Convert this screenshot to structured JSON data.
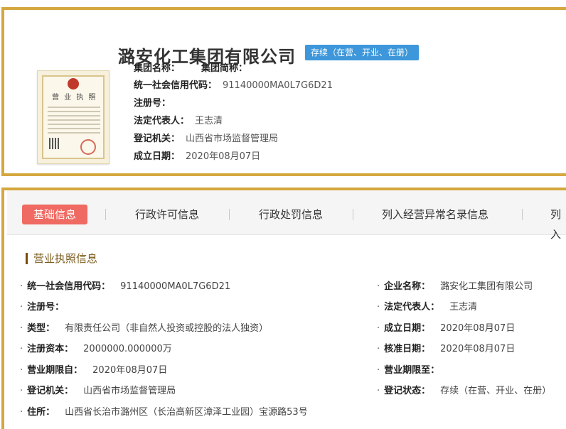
{
  "company": {
    "name": "潞安化工集团有限公司",
    "status": "存续（在营、开业、在册）",
    "license_image_title": "营 业 执 照"
  },
  "summary": [
    {
      "label": "集团名称：",
      "value": "",
      "label2": "集团简称："
    },
    {
      "label": "统一社会信用代码：",
      "value": "91140000MA0L7G6D21"
    },
    {
      "label": "注册号：",
      "value": ""
    },
    {
      "label": "法定代表人：",
      "value": "王志清"
    },
    {
      "label": "登记机关：",
      "value": "山西省市场监督管理局"
    },
    {
      "label": "成立日期：",
      "value": "2020年08月07日"
    }
  ],
  "tabs": [
    "基础信息",
    "行政许可信息",
    "行政处罚信息",
    "列入经营异常名录信息",
    "列入"
  ],
  "section": {
    "title": "营业执照信息"
  },
  "fields_left": [
    {
      "label": "统一社会信用代码：",
      "value": "91140000MA0L7G6D21"
    },
    {
      "label": "注册号：",
      "value": ""
    },
    {
      "label": "类型：",
      "value": "有限责任公司（非自然人投资或控股的法人独资）"
    },
    {
      "label": "注册资本：",
      "value": "2000000.000000万"
    },
    {
      "label": "营业期限自：",
      "value": "2020年08月07日"
    },
    {
      "label": "登记机关：",
      "value": "山西省市场监督管理局"
    },
    {
      "label": "住所：",
      "value": "山西省长治市潞州区（长治高新区漳泽工业园）宝源路53号"
    }
  ],
  "fields_right": [
    {
      "label": "企业名称：",
      "value": "潞安化工集团有限公司"
    },
    {
      "label": "法定代表人：",
      "value": "王志清"
    },
    {
      "label": "成立日期：",
      "value": "2020年08月07日"
    },
    {
      "label": "核准日期：",
      "value": "2020年08月07日"
    },
    {
      "label": "营业期限至：",
      "value": ""
    },
    {
      "label": "登记状态：",
      "value": "存续（在营、开业、在册）"
    }
  ],
  "colors": {
    "border": "#d4a73f",
    "badge": "#3d97da",
    "active_tab": "#ef6a62"
  }
}
